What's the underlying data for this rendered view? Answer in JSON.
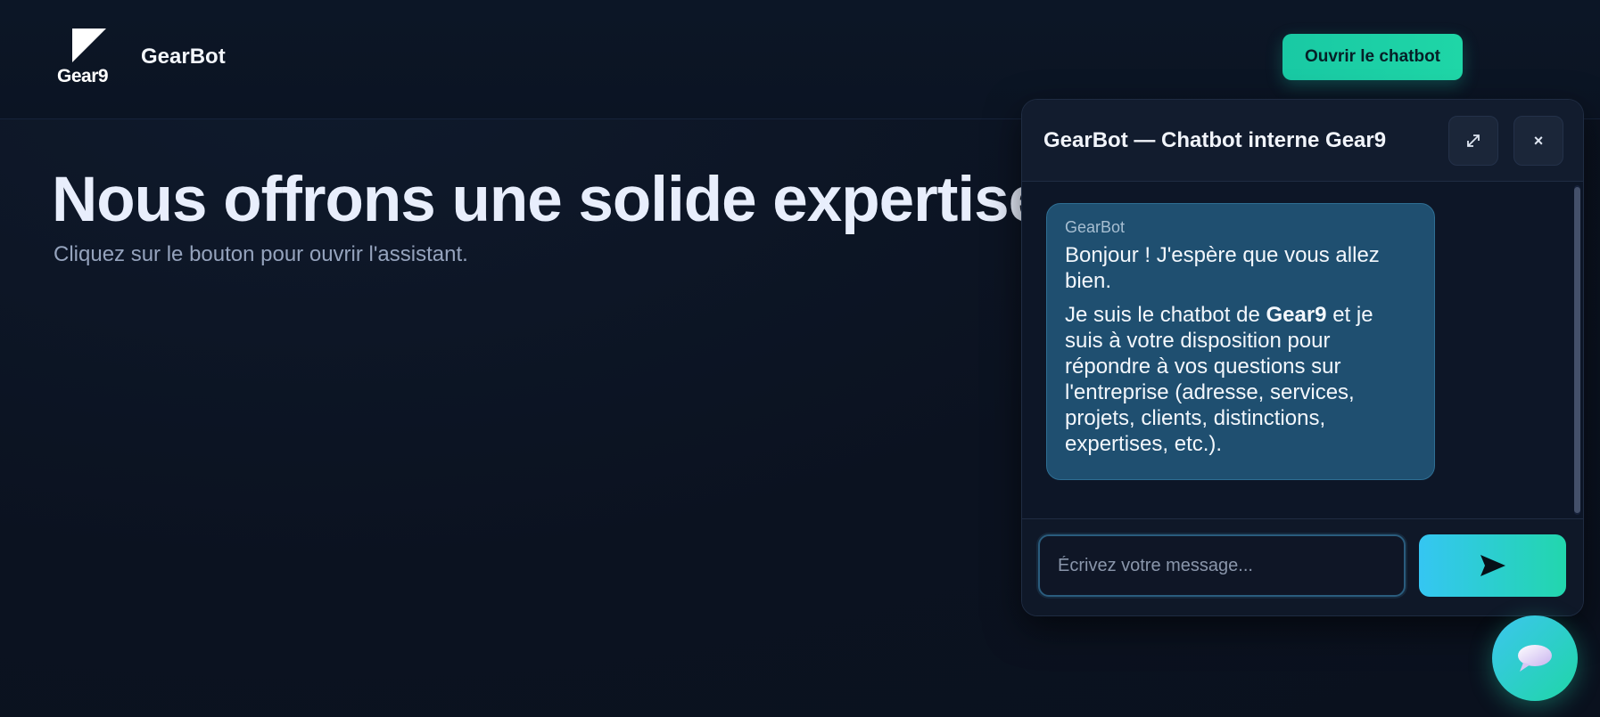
{
  "header": {
    "logo_text": "Gear9",
    "brand_title": "GearBot",
    "open_chatbot_label": "Ouvrir le chatbot"
  },
  "hero": {
    "title": "Nous offrons une solide expertise",
    "subtitle": "Cliquez sur le bouton pour ouvrir l'assistant."
  },
  "chat": {
    "title": "GearBot — Chatbot interne Gear9",
    "expand_icon": "expand-icon",
    "close_label": "×",
    "messages": [
      {
        "sender": "GearBot",
        "paragraph_1": "Bonjour ! J'espère que vous allez bien.",
        "paragraph_2_before": "Je suis le chatbot de ",
        "paragraph_2_bold": "Gear9",
        "paragraph_2_after": " et je suis à votre disposition pour répondre à vos questions sur l'entreprise (adresse, services, projets, clients, distinctions, expertises, etc.)."
      }
    ],
    "input_placeholder": "Écrivez votre message...",
    "send_icon": "send-icon"
  },
  "fab_icon": "chat-bubble-icon",
  "colors": {
    "background": "#0b1220",
    "accent_teal": "#1fd6a7",
    "accent_cyan": "#35c6f2",
    "bubble": "#1f4f70"
  }
}
